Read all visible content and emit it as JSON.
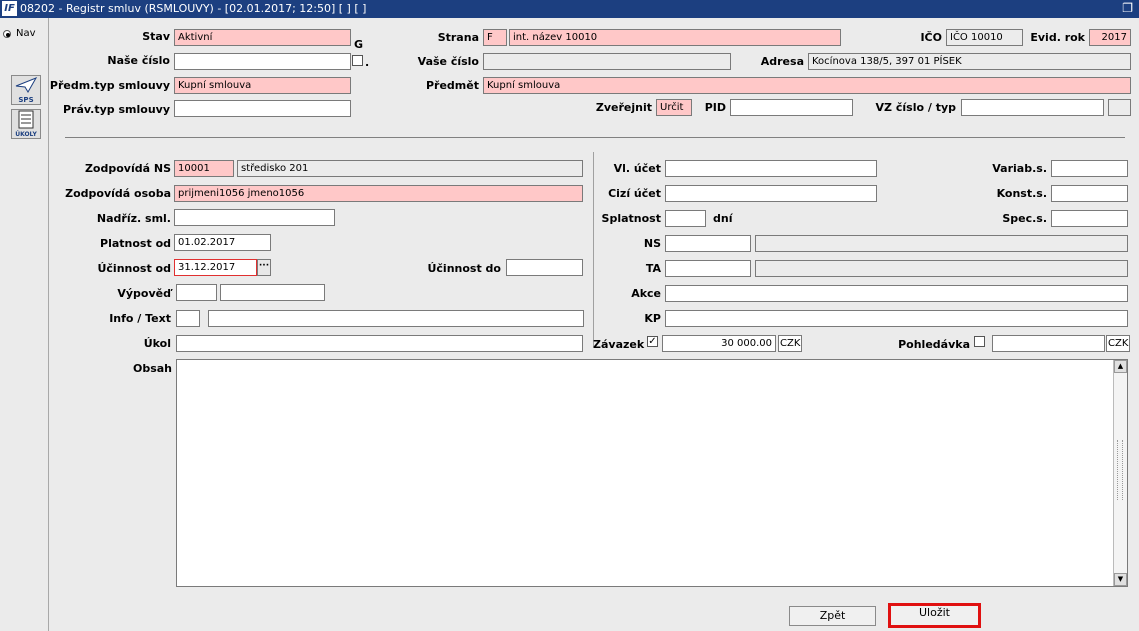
{
  "window": {
    "icon_text": "IF",
    "title": "08202 - Registr smluv (RSMLOUVY) - [02.01.2017; 12:50] [ ] [ ]",
    "restore_icon": "restore-window-icon"
  },
  "nav": {
    "label": "Nav",
    "tools": [
      {
        "name": "sps-tool",
        "label": "SPS"
      },
      {
        "name": "ukoly-tool",
        "label": "ÚKOLY"
      }
    ]
  },
  "header": {
    "stav": {
      "label": "Stav",
      "value": "Aktivní"
    },
    "g_label": "G",
    "dot_label": ".",
    "nase_cislo": {
      "label": "Naše číslo",
      "value": ""
    },
    "predm_typ": {
      "label": "Předm.typ smlouvy",
      "value": "Kupní smlouva"
    },
    "prav_typ": {
      "label": "Práv.typ smlouvy",
      "value": ""
    },
    "strana": {
      "label": "Strana",
      "code": "F",
      "value": "int. název 10010"
    },
    "vase_cislo": {
      "label": "Vaše číslo",
      "value": ""
    },
    "predmet": {
      "label": "Předmět",
      "value": "Kupní smlouva"
    },
    "zverejnit": {
      "label": "Zveřejnit",
      "value": "Určit"
    },
    "pid": {
      "label": "PID",
      "value": ""
    },
    "ico": {
      "label": "IČO",
      "value": "IČO 10010"
    },
    "evid_rok": {
      "label": "Evid. rok",
      "value": "2017"
    },
    "adresa": {
      "label": "Adresa",
      "value": "Kocínova 138/5, 397 01 PÍSEK"
    },
    "vz_cislo": {
      "label": "VZ číslo / typ",
      "value": "",
      "typ": ""
    }
  },
  "left": {
    "zodp_ns": {
      "label": "Zodpovídá NS",
      "code": "10001",
      "value": "středisko 201"
    },
    "zodp_osoba": {
      "label": "Zodpovídá osoba",
      "value": "prijmeni1056 jmeno1056"
    },
    "nadriz": {
      "label": "Nadříz. sml.",
      "value": ""
    },
    "platnost_od": {
      "label": "Platnost od",
      "value": "01.02.2017"
    },
    "ucinnost_od": {
      "label": "Účinnost od",
      "value": "31.12.2017"
    },
    "ucinnost_do": {
      "label": "Účinnost do",
      "value": ""
    },
    "vypoved": {
      "label": "Výpověď",
      "value1": "",
      "value2": ""
    },
    "info_text": {
      "label": "Info / Text",
      "value1": "",
      "value2": ""
    },
    "ukol": {
      "label": "Úkol",
      "value": ""
    }
  },
  "right": {
    "vl_ucet": {
      "label": "Vl. účet",
      "value": ""
    },
    "cizi_ucet": {
      "label": "Cizí účet",
      "value": ""
    },
    "splatnost": {
      "label": "Splatnost",
      "value": "",
      "unit": "dní"
    },
    "ns": {
      "label": "NS",
      "value": "",
      "desc": ""
    },
    "ta": {
      "label": "TA",
      "value": "",
      "desc": ""
    },
    "akce": {
      "label": "Akce",
      "value": ""
    },
    "kp": {
      "label": "KP",
      "value": ""
    },
    "variab": {
      "label": "Variab.s.",
      "value": ""
    },
    "konst": {
      "label": "Konst.s.",
      "value": ""
    },
    "spec": {
      "label": "Spec.s.",
      "value": ""
    },
    "zavazek": {
      "label": "Závazek",
      "checked": "✓",
      "value": "30 000.00",
      "currency": "CZK"
    },
    "pohledavka": {
      "label": "Pohledávka",
      "checked": "",
      "value": "",
      "currency": "CZK"
    }
  },
  "obsah": {
    "label": "Obsah",
    "value": ""
  },
  "buttons": {
    "zpet": "Zpět",
    "ulozit": "Uložit"
  },
  "colors": {
    "title_bar": "#1c3f80",
    "required_field": "#ffc8c8",
    "highlight_border": "#e01010"
  }
}
